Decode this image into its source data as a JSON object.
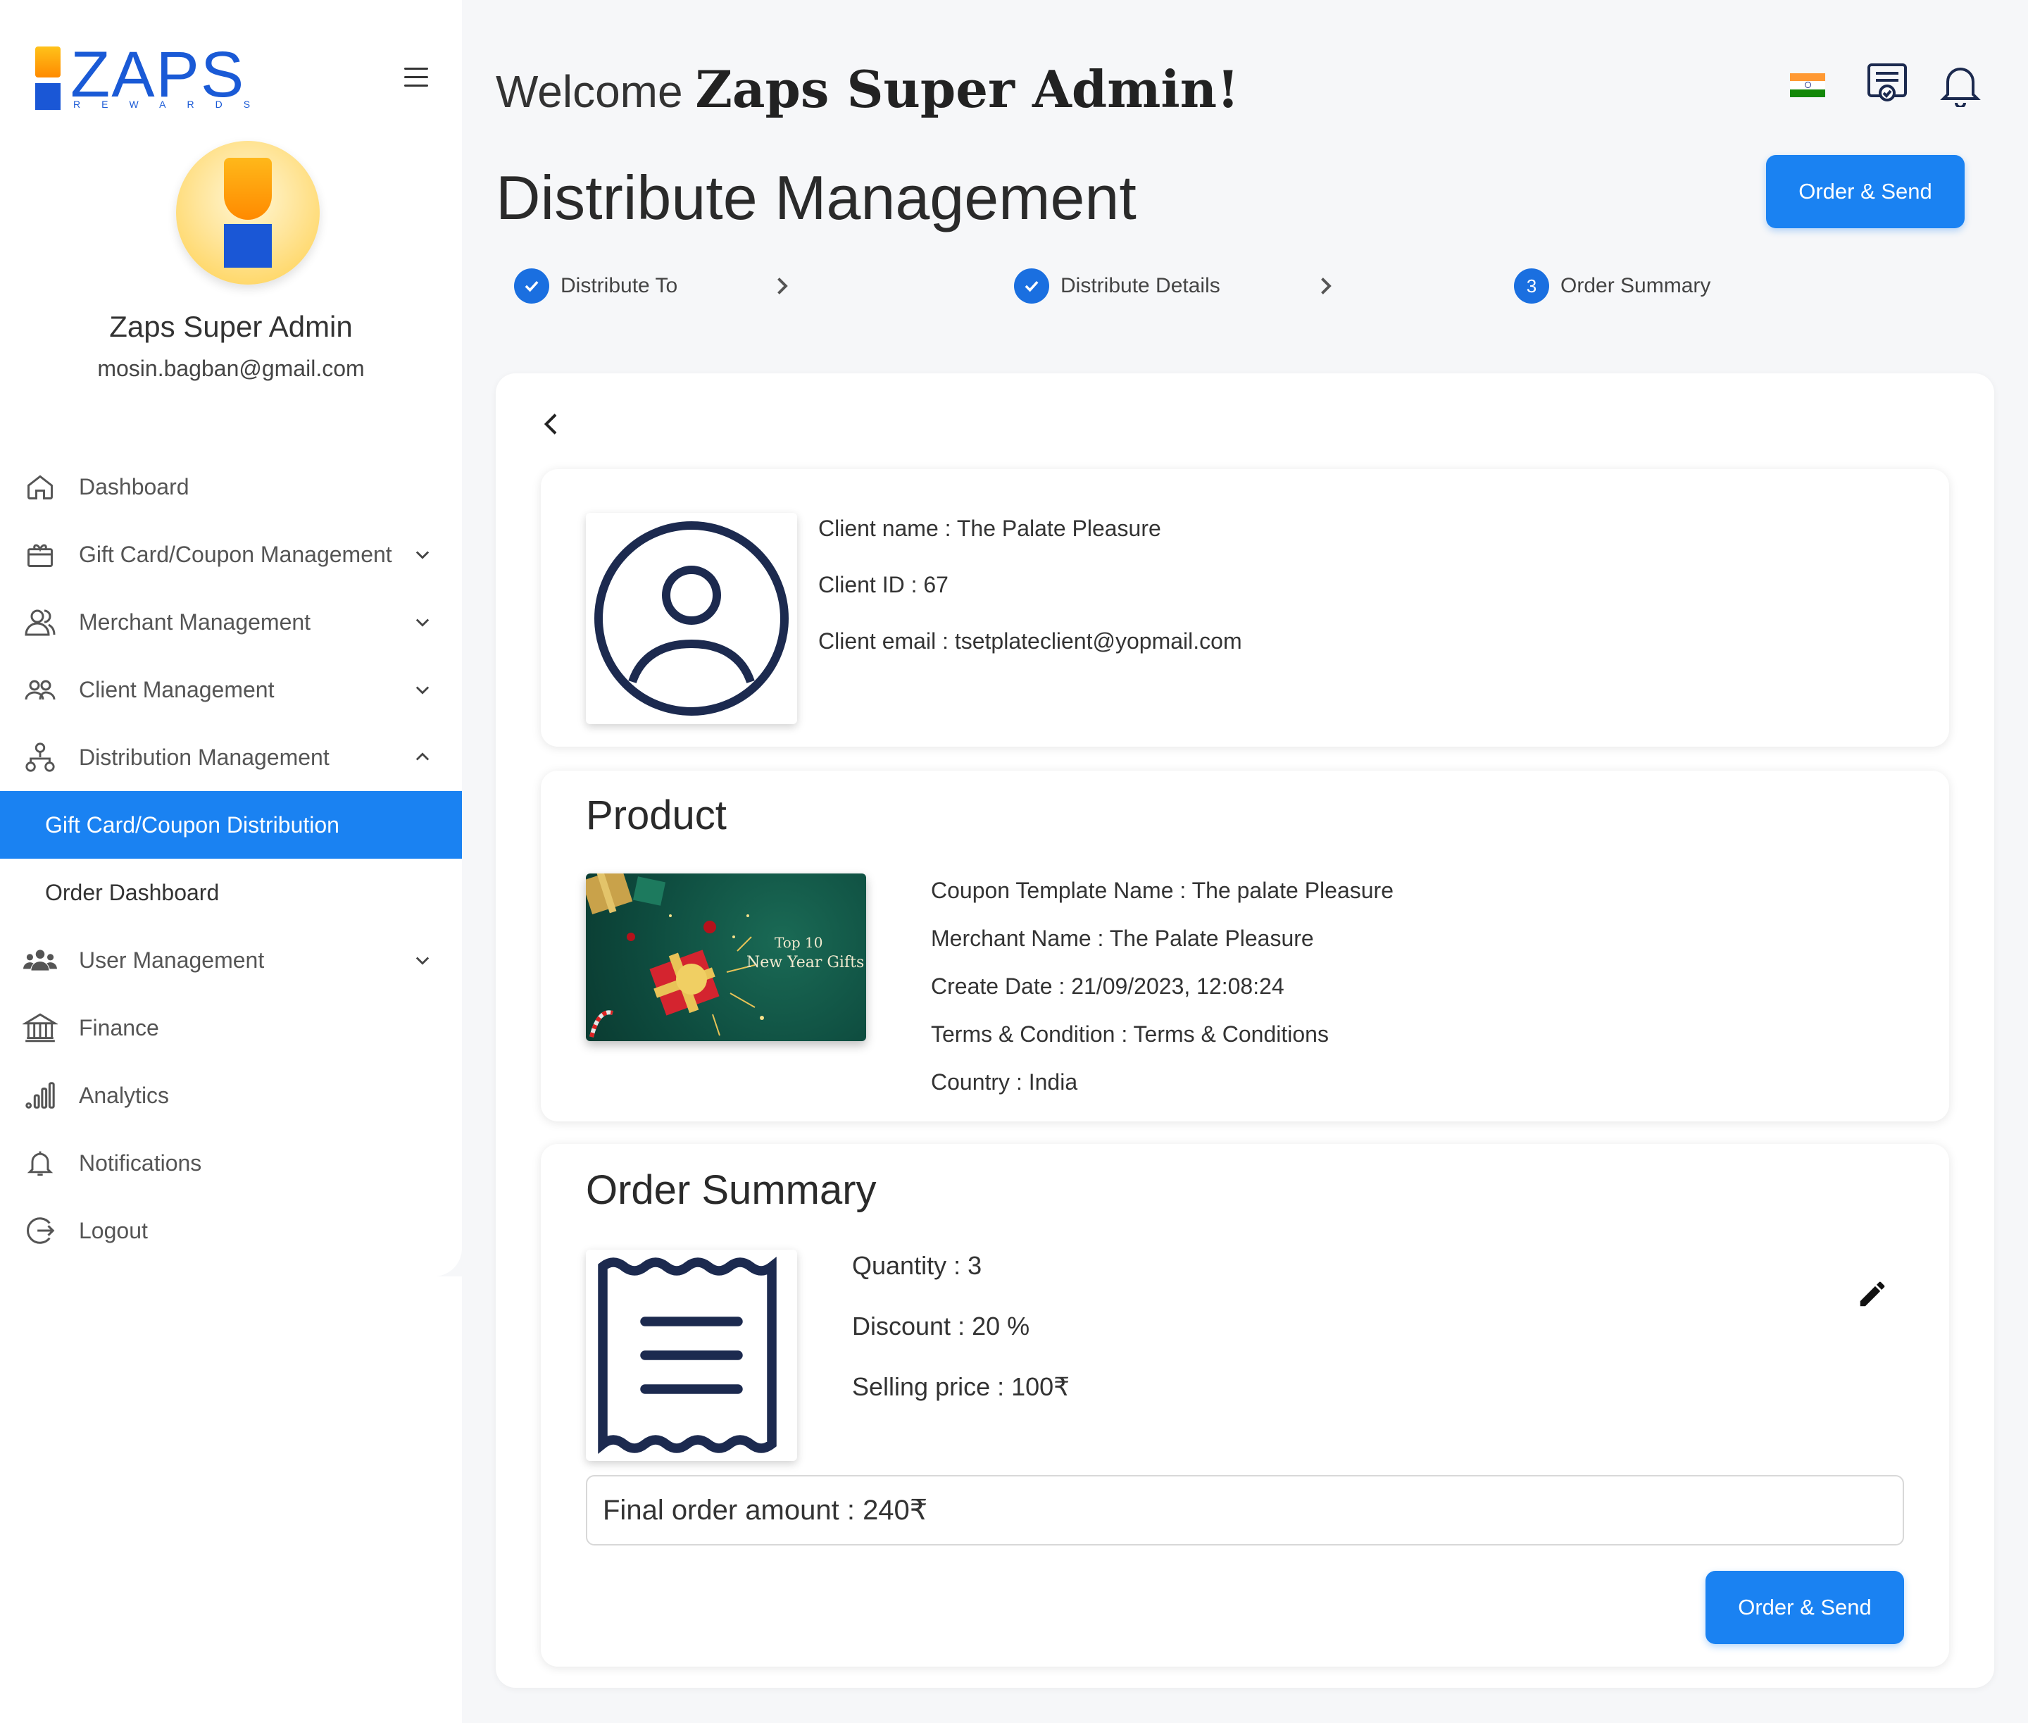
{
  "brand": {
    "name": "ZAPS",
    "sub": "REWARDS"
  },
  "profile": {
    "name": "Zaps Super Admin",
    "email": "mosin.bagban@gmail.com"
  },
  "nav": {
    "dashboard": "Dashboard",
    "giftcard": "Gift Card/Coupon Management",
    "merchant": "Merchant Management",
    "client": "Client Management",
    "distribution": "Distribution Management",
    "sub_distribution": "Gift Card/Coupon Distribution",
    "sub_order_dashboard": "Order Dashboard",
    "user": "User Management",
    "finance": "Finance",
    "analytics": "Analytics",
    "notifications": "Notifications",
    "logout": "Logout"
  },
  "header": {
    "welcome_prefix": "Welcome",
    "welcome_name": "Zaps Super Admin!",
    "page_title": "Distribute Management",
    "order_send": "Order & Send"
  },
  "stepper": {
    "step1": "Distribute To",
    "step2": "Distribute Details",
    "step3_number": "3",
    "step3": "Order Summary"
  },
  "client": {
    "name": "Client name : The Palate Pleasure",
    "id": "Client ID : 67",
    "email": "Client email : tsetplateclient@yopmail.com"
  },
  "product": {
    "title": "Product",
    "image_line1": "Top 10",
    "image_line2": "New Year Gifts",
    "template": "Coupon Template Name : The palate Pleasure",
    "merchant": "Merchant Name : The Palate Pleasure",
    "create_date": "Create Date : 21/09/2023, 12:08:24",
    "terms": "Terms & Condition : Terms & Conditions",
    "country": "Country : India"
  },
  "order_summary": {
    "title": "Order Summary",
    "quantity": "Quantity : 3",
    "discount": "Discount : 20 %",
    "selling_price": "Selling price : 100₹",
    "final_amount": "Final order amount : 240₹",
    "order_send": "Order & Send"
  },
  "colors": {
    "accent": "#1a82f2",
    "navy": "#1c2a4f",
    "brand_blue": "#1a5ad6",
    "brand_orange": "#ff9a00"
  }
}
